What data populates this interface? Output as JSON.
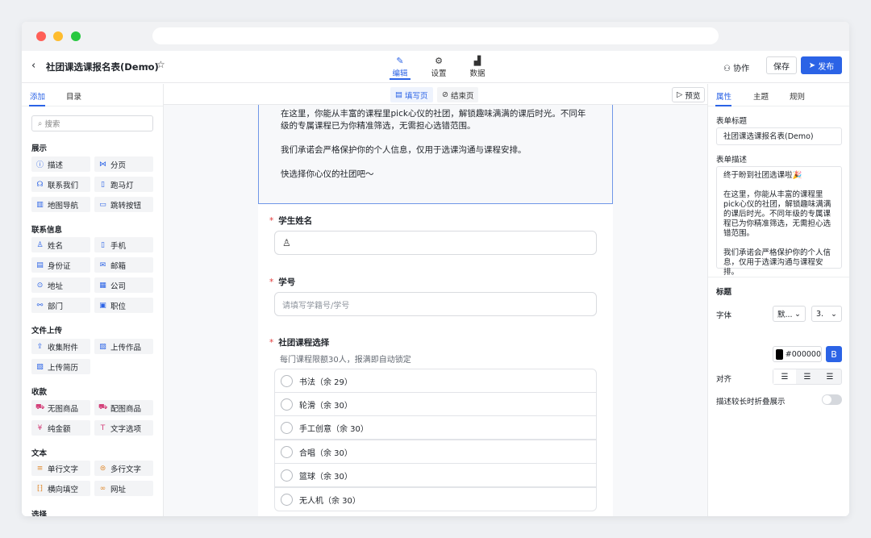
{
  "app": {
    "title": "社团课选课报名表(Demo)"
  },
  "topbar": {
    "modes": [
      {
        "label": "编辑",
        "icon": "pencil-icon",
        "active": true
      },
      {
        "label": "设置",
        "icon": "gear-icon",
        "active": false
      },
      {
        "label": "数据",
        "icon": "chart-icon",
        "active": false
      }
    ],
    "collab_label": "协作",
    "save_label": "保存",
    "publish_label": "发布"
  },
  "left": {
    "tabs": [
      "添加",
      "目录"
    ],
    "search_placeholder": "搜索",
    "sections": [
      {
        "title": "展示",
        "items": [
          {
            "label": "描述",
            "icon": "info-icon"
          },
          {
            "label": "分页",
            "icon": "pagination-icon"
          },
          {
            "label": "联系我们",
            "icon": "headset-icon"
          },
          {
            "label": "跑马灯",
            "icon": "marquee-icon"
          },
          {
            "label": "地图导航",
            "icon": "map-icon"
          },
          {
            "label": "跳转按钮",
            "icon": "jump-button-icon"
          }
        ]
      },
      {
        "title": "联系信息",
        "items": [
          {
            "label": "姓名",
            "icon": "person-icon"
          },
          {
            "label": "手机",
            "icon": "phone-icon"
          },
          {
            "label": "身份证",
            "icon": "id-card-icon"
          },
          {
            "label": "邮箱",
            "icon": "mail-icon"
          },
          {
            "label": "地址",
            "icon": "location-icon"
          },
          {
            "label": "公司",
            "icon": "building-icon"
          },
          {
            "label": "部门",
            "icon": "org-icon"
          },
          {
            "label": "职位",
            "icon": "briefcase-icon"
          }
        ]
      },
      {
        "title": "文件上传",
        "items": [
          {
            "label": "收集附件",
            "icon": "upload-icon"
          },
          {
            "label": "上传作品",
            "icon": "image-icon"
          },
          {
            "label": "上传简历",
            "icon": "resume-icon"
          }
        ]
      },
      {
        "title": "收款",
        "items": [
          {
            "label": "无图商品",
            "icon": "cart-icon"
          },
          {
            "label": "配图商品",
            "icon": "cart-image-icon"
          },
          {
            "label": "纯金额",
            "icon": "yen-icon"
          },
          {
            "label": "文字选项",
            "icon": "text-option-icon"
          }
        ]
      },
      {
        "title": "文本",
        "items": [
          {
            "label": "单行文字",
            "icon": "single-line-icon"
          },
          {
            "label": "多行文字",
            "icon": "multi-line-icon"
          },
          {
            "label": "横向填空",
            "icon": "fill-blank-icon"
          },
          {
            "label": "网址",
            "icon": "link-icon"
          }
        ]
      },
      {
        "title": "选择",
        "items": []
      }
    ]
  },
  "center": {
    "page_tabs": [
      {
        "label": "填写页",
        "icon": "doc-icon"
      },
      {
        "label": "结束页",
        "icon": "check-circle-icon"
      }
    ],
    "preview_label": "预览",
    "description": [
      "在这里，你能从丰富的课程里pick心仪的社团，解锁趣味满满的课后时光。不同年级的专属课程已为你精准筛选，无需担心选错范围。",
      "我们承诺会严格保护你的个人信息，仅用于选课沟通与课程安排。",
      "快选择你心仪的社团吧～"
    ],
    "questions": [
      {
        "required_mark": "*",
        "title": "学生姓名",
        "placeholder": ""
      },
      {
        "required_mark": "*",
        "title": "学号",
        "placeholder": "请填写学籍号/学号"
      },
      {
        "required_mark": "*",
        "title": "社团课程选择",
        "subtitle": "每门课程限额30人，报满即自动锁定",
        "options": [
          "书法（余 29）",
          "轮滑（余 30）",
          "手工创意（余 30）",
          "合唱（余 30）",
          "篮球（余 30）",
          "无人机（余 30）"
        ]
      }
    ]
  },
  "right": {
    "tabs": [
      "属性",
      "主题",
      "规则"
    ],
    "form_title_label": "表单标题",
    "form_title_value": "社团课选课报名表(Demo)",
    "form_desc_label": "表单描述",
    "form_desc_lines": [
      "终于盼到社团选课啦🎉",
      "在这里，你能从丰富的课程里pick心仪的社团，解锁趣味满满的课后时光。不同年级的专属课程已为你精准筛选，无需担心选错范围。",
      "我们承诺会严格保护你的个人信息，仅用于选课沟通与课程安排。"
    ],
    "heading_section": "标题",
    "font_label": "字体",
    "font_value": "默...",
    "size_value": "3.",
    "color_value": "#000000",
    "bold_label": "B",
    "align_label": "对齐",
    "collapse_label": "描述较长时折叠展示"
  }
}
